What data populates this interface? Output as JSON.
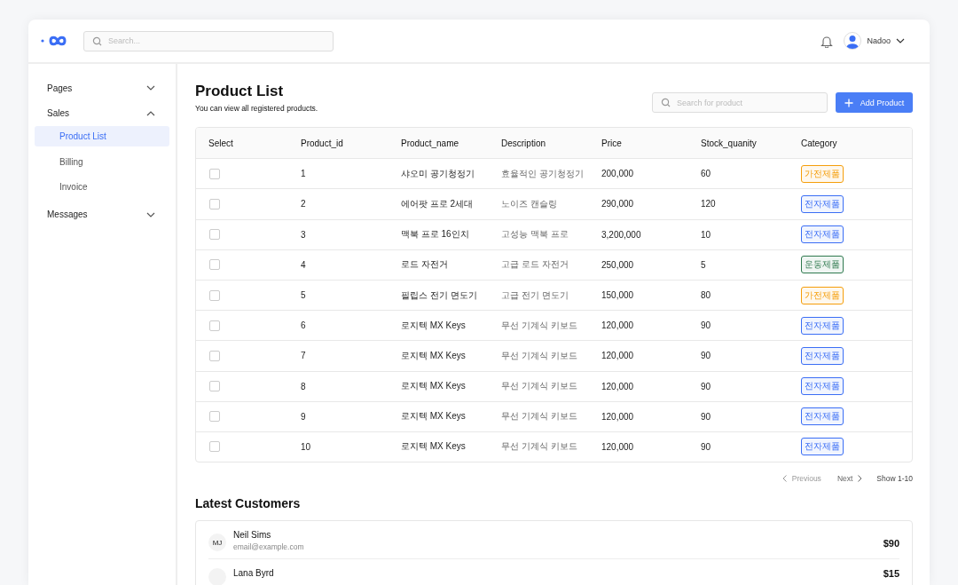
{
  "header": {
    "search": {
      "placeholder": "Search..."
    },
    "user": {
      "name": "Nadoo"
    }
  },
  "sidebar": {
    "items": [
      {
        "label": "Pages",
        "expanded": false
      },
      {
        "label": "Sales",
        "expanded": true,
        "children": [
          {
            "label": "Product List",
            "selected": true
          },
          {
            "label": "Billing",
            "selected": false
          },
          {
            "label": "Invoice",
            "selected": false
          }
        ]
      },
      {
        "label": "Messages",
        "expanded": false
      }
    ]
  },
  "page": {
    "title": "Product List",
    "subtitle": "You can view all registered products.",
    "search": {
      "placeholder": "Search for product"
    },
    "add_button": "Add Product"
  },
  "table": {
    "columns": [
      "Select",
      "Product_id",
      "Product_name",
      "Description",
      "Price",
      "Stock_quanity",
      "Category"
    ],
    "rows": [
      {
        "checked": false,
        "id": "1",
        "name": "샤오미 공기청정기",
        "description": "효율적인 공기청정기",
        "price": "200,000",
        "stock": "60",
        "category": {
          "label": "가전제품",
          "color": "#f59e0b"
        }
      },
      {
        "checked": false,
        "id": "2",
        "name": "에어팟 프로 2세대",
        "description": "노이즈 캔슬링",
        "price": "290,000",
        "stock": "120",
        "category": {
          "label": "전자제품",
          "color": "#3b6ef5"
        }
      },
      {
        "checked": false,
        "id": "3",
        "name": "맥북 프로 16인치",
        "description": "고성능 맥북 프로",
        "price": "3,200,000",
        "stock": "10",
        "category": {
          "label": "전자제품",
          "color": "#3b6ef5"
        }
      },
      {
        "checked": false,
        "id": "4",
        "name": "로드 자전거",
        "description": "고급 로드 자전거",
        "price": "250,000",
        "stock": "5",
        "category": {
          "label": "운동제품",
          "color": "#2f7a4f"
        }
      },
      {
        "checked": false,
        "id": "5",
        "name": "필립스 전기 면도기",
        "description": "고급 전기 면도기",
        "price": "150,000",
        "stock": "80",
        "category": {
          "label": "가전제품",
          "color": "#f59e0b"
        }
      },
      {
        "checked": false,
        "id": "6",
        "name": "로지텍 MX Keys",
        "description": "무선 기계식 키보드",
        "price": "120,000",
        "stock": "90",
        "category": {
          "label": "전자제품",
          "color": "#3b6ef5"
        }
      },
      {
        "checked": false,
        "id": "7",
        "name": "로지텍 MX Keys",
        "description": "무선 기계식 키보드",
        "price": "120,000",
        "stock": "90",
        "category": {
          "label": "전자제품",
          "color": "#3b6ef5"
        }
      },
      {
        "checked": false,
        "id": "8",
        "name": "로지텍 MX Keys",
        "description": "무선 기계식 키보드",
        "price": "120,000",
        "stock": "90",
        "category": {
          "label": "전자제품",
          "color": "#3b6ef5"
        }
      },
      {
        "checked": false,
        "id": "9",
        "name": "로지텍 MX Keys",
        "description": "무선 기계식 키보드",
        "price": "120,000",
        "stock": "90",
        "category": {
          "label": "전자제품",
          "color": "#3b6ef5"
        }
      },
      {
        "checked": false,
        "id": "10",
        "name": "로지텍 MX Keys",
        "description": "무선 기계식 키보드",
        "price": "120,000",
        "stock": "90",
        "category": {
          "label": "전자제품",
          "color": "#3b6ef5"
        }
      }
    ]
  },
  "pagination": {
    "previous": {
      "label": "Previous",
      "disabled": true
    },
    "next": {
      "label": "Next",
      "disabled": false
    },
    "range": "Show 1-10"
  },
  "customers": {
    "title": "Latest Customers",
    "items": [
      {
        "initials": "MJ",
        "name": "Neil Sims",
        "email": "email@example.com",
        "amount": "$90"
      },
      {
        "name": "Lana Byrd",
        "amount": "$15"
      }
    ]
  }
}
